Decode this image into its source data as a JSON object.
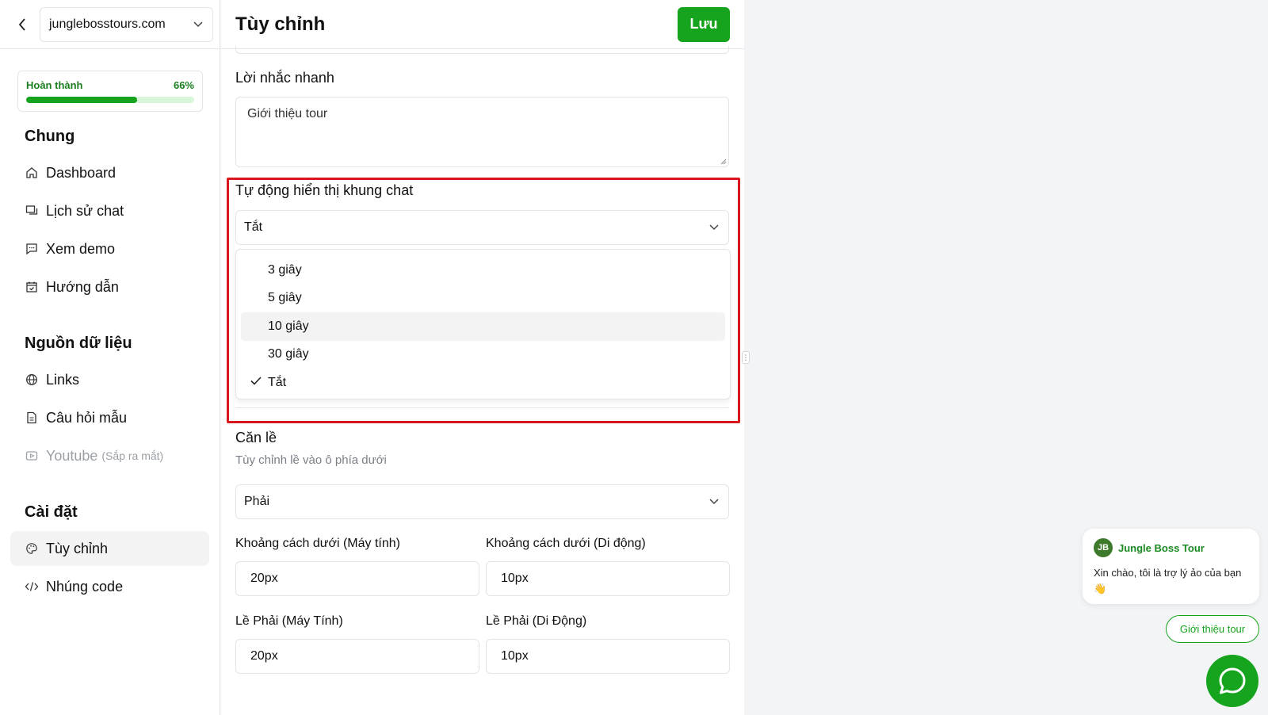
{
  "sidebar": {
    "domain": "junglebosstours.com",
    "progress": {
      "label": "Hoàn thành",
      "percent_text": "66%",
      "value": 0.66
    },
    "sections": {
      "general": "Chung",
      "data_sources": "Nguồn dữ liệu",
      "settings": "Cài đặt"
    },
    "items": {
      "dashboard": "Dashboard",
      "chat_history": "Lịch sử chat",
      "demo": "Xem demo",
      "guide": "Hướng dẫn",
      "links": "Links",
      "sample_questions": "Câu hỏi mẫu",
      "youtube": "Youtube",
      "youtube_soon": "(Sắp ra mắt)",
      "customize": "Tùy chỉnh",
      "embed": "Nhúng code"
    }
  },
  "main": {
    "title": "Tùy chỉnh",
    "save_label": "Lưu",
    "quick_prompt": {
      "label": "Lời nhắc nhanh",
      "value": "Giới thiệu tour"
    },
    "auto_show": {
      "label": "Tự động hiển thị khung chat",
      "selected": "Tắt",
      "options": [
        "3 giây",
        "5 giây",
        "10 giây",
        "30 giây",
        "Tắt"
      ]
    },
    "alignment": {
      "label": "Căn lề",
      "hint": "Tùy chỉnh lề vào ô phía dưới",
      "selected": "Phải"
    },
    "bottom_desktop": {
      "label": "Khoảng cách dưới (Máy tính)",
      "value": "20px"
    },
    "bottom_mobile": {
      "label": "Khoảng cách dưới (Di động)",
      "value": "10px"
    },
    "right_desktop": {
      "label": "Lề Phải (Máy Tính)",
      "value": "20px"
    },
    "right_mobile": {
      "label": "Lề Phải (Di Động)",
      "value": "10px"
    }
  },
  "chat_widget": {
    "logo_text": "JB",
    "bot_name": "Jungle Boss Tour",
    "greeting": "Xin chào, tôi là trợ lý ảo của bạn 👋",
    "quick_reply": "Giới thiệu tour"
  },
  "colors": {
    "accent": "#16a31d",
    "highlight": "#d8161b"
  }
}
